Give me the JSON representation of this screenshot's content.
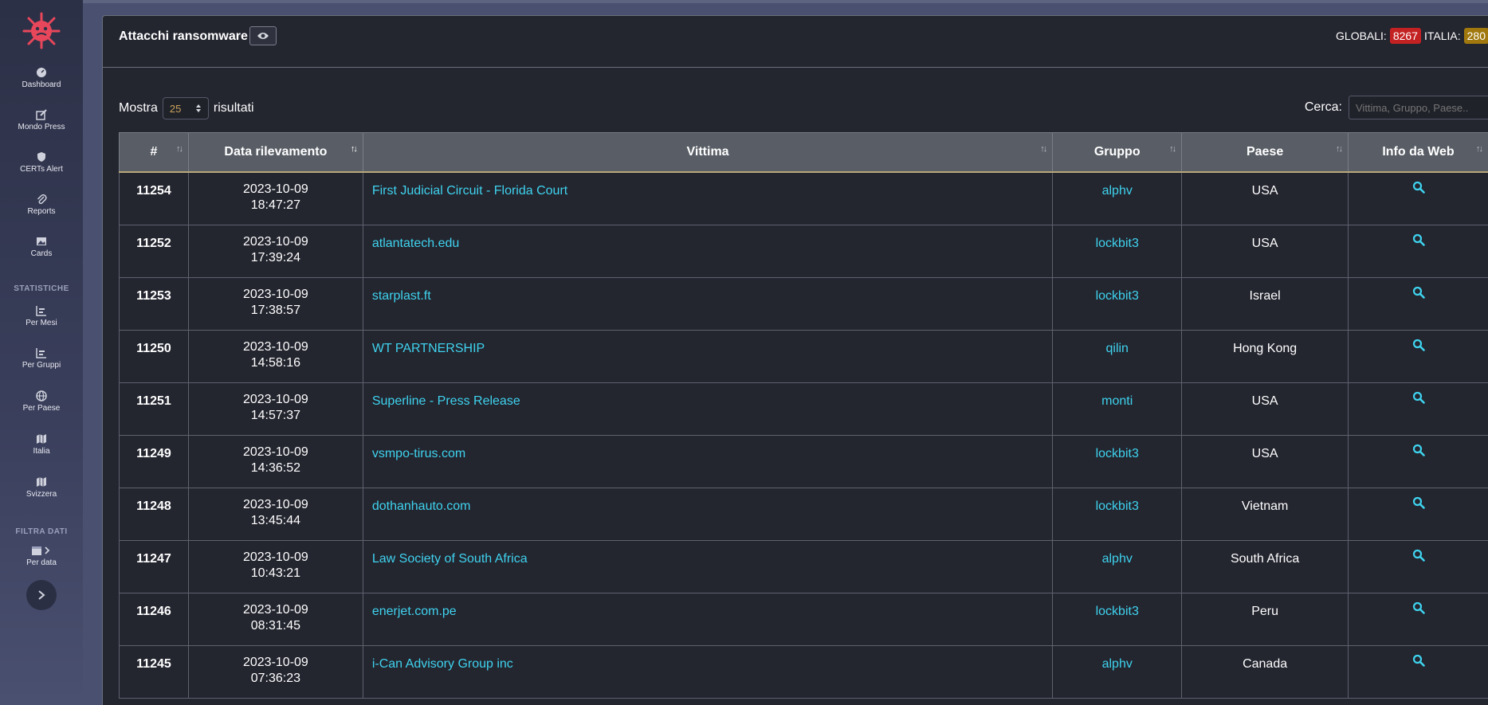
{
  "header": {
    "title": "Attacchi ransomware",
    "globali_label": "GLOBALI:",
    "globali_value": "8267",
    "italia_label": "ITALIA:",
    "italia_value": "280"
  },
  "sidebar": {
    "items": [
      {
        "label": "Dashboard",
        "icon": "dashboard-icon"
      },
      {
        "label": "Mondo Press",
        "icon": "edit-icon"
      },
      {
        "label": "CERTs Alert",
        "icon": "shield-icon"
      },
      {
        "label": "Reports",
        "icon": "paperclip-icon"
      },
      {
        "label": "Cards",
        "icon": "image-icon"
      }
    ],
    "section_stats": "STATISTICHE",
    "stats_items": [
      {
        "label": "Per Mesi",
        "icon": "bar-chart-icon"
      },
      {
        "label": "Per Gruppi",
        "icon": "bar-chart-icon"
      },
      {
        "label": "Per Paese",
        "icon": "globe-icon"
      },
      {
        "label": "Italia",
        "icon": "map-icon"
      },
      {
        "label": "Svizzera",
        "icon": "map-icon"
      }
    ],
    "section_filter": "FILTRA DATI",
    "filter_items": [
      {
        "label": "Per data",
        "icon": "calendar-icon"
      }
    ]
  },
  "controls": {
    "show_label": "Mostra",
    "page_size": "25",
    "results_label": "risultati",
    "search_label": "Cerca:",
    "search_placeholder": "Vittima, Gruppo, Paese.."
  },
  "table": {
    "columns": [
      "#",
      "Data rilevamento",
      "Vittima",
      "Gruppo",
      "Paese",
      "Info da Web"
    ],
    "rows": [
      {
        "id": "11254",
        "date": "2023-10-09",
        "time": "18:47:27",
        "victim": "First Judicial Circuit - Florida Court",
        "group": "alphv",
        "country": "USA"
      },
      {
        "id": "11252",
        "date": "2023-10-09",
        "time": "17:39:24",
        "victim": "atlantatech.edu",
        "group": "lockbit3",
        "country": "USA"
      },
      {
        "id": "11253",
        "date": "2023-10-09",
        "time": "17:38:57",
        "victim": "starplast.ft",
        "group": "lockbit3",
        "country": "Israel"
      },
      {
        "id": "11250",
        "date": "2023-10-09",
        "time": "14:58:16",
        "victim": "WT PARTNERSHIP",
        "group": "qilin",
        "country": "Hong Kong"
      },
      {
        "id": "11251",
        "date": "2023-10-09",
        "time": "14:57:37",
        "victim": "Superline - Press Release",
        "group": "monti",
        "country": "USA"
      },
      {
        "id": "11249",
        "date": "2023-10-09",
        "time": "14:36:52",
        "victim": "vsmpo-tirus.com",
        "group": "lockbit3",
        "country": "USA"
      },
      {
        "id": "11248",
        "date": "2023-10-09",
        "time": "13:45:44",
        "victim": "dothanhauto.com",
        "group": "lockbit3",
        "country": "Vietnam"
      },
      {
        "id": "11247",
        "date": "2023-10-09",
        "time": "10:43:21",
        "victim": "Law Society of South Africa",
        "group": "alphv",
        "country": "South Africa"
      },
      {
        "id": "11246",
        "date": "2023-10-09",
        "time": "08:31:45",
        "victim": "enerjet.com.pe",
        "group": "lockbit3",
        "country": "Peru"
      },
      {
        "id": "11245",
        "date": "2023-10-09",
        "time": "07:36:23",
        "victim": "i-Can Advisory Group inc",
        "group": "alphv",
        "country": "Canada"
      }
    ]
  },
  "colors": {
    "accent_link": "#3fd3ee",
    "badge_global": "#c42222",
    "badge_italy": "#a0780e",
    "panel_bg": "#23252f"
  }
}
